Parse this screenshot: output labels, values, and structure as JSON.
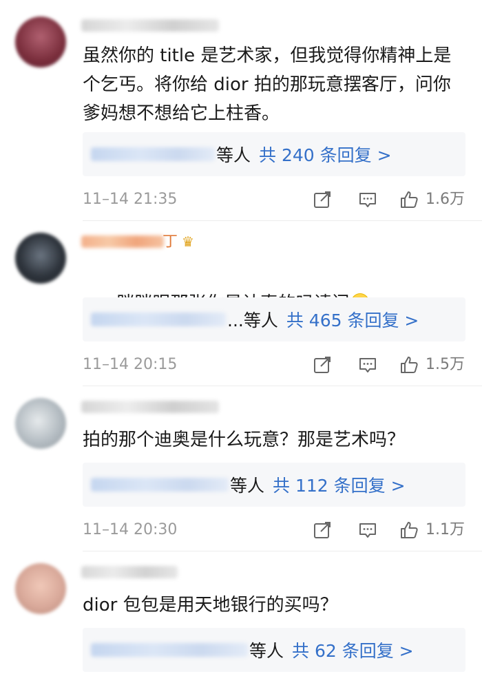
{
  "comments": [
    {
      "text": "虽然你的 title 是艺术家，但我觉得你精神上是个乞丐。将你给 dior 拍的那玩意摆客厅，问你爹妈想不想给它上柱香。",
      "reply_suffix": "等人",
      "reply_link": "共 240 条回复 >",
      "time": "11–14 21:35",
      "likes": "1.6万",
      "avatar_color": "#8a3a4a"
    },
    {
      "text": "眯眯眼那张你是认真的吗请问",
      "reply_suffix": "...等人",
      "reply_link": "共 465 条回复 >",
      "time": "11–14 20:15",
      "likes": "1.5万",
      "avatar_color": "#3a4048",
      "nickname_tail": "丁",
      "emoji_icon": "smile-emoji-icon"
    },
    {
      "text": "拍的那个迪奥是什么玩意？那是艺术吗？",
      "reply_suffix": "等人",
      "reply_link": "共 112 条回复 >",
      "time": "11–14 20:30",
      "likes": "1.1万",
      "avatar_color": "#a9b2b8"
    },
    {
      "text": "dior 包包是用天地银行的买吗？",
      "reply_suffix": "等人",
      "reply_link": "共 62 条回复 >",
      "time": "",
      "likes": "",
      "avatar_color": "#d9a99a"
    }
  ],
  "colors": {
    "link": "#3470c9",
    "meta": "#9a9a9a",
    "reply_bg": "#f6f7f9",
    "crown": "#e0a21a"
  },
  "icons": [
    "repost-icon",
    "comment-icon",
    "like-icon",
    "crown-badge-icon"
  ]
}
